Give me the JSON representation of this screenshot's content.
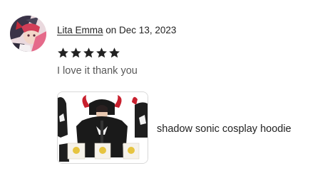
{
  "review": {
    "author": "Lita Emma",
    "date_text": " on Dec 13, 2023",
    "rating": 5,
    "text": "I love it thank you"
  },
  "item": {
    "title": "shadow sonic cosplay hoodie"
  },
  "icons": {
    "avatar": "avatar-image",
    "star": "star-icon"
  },
  "colors": {
    "text": "#222222",
    "muted_text": "#595959",
    "star": "#222222"
  }
}
